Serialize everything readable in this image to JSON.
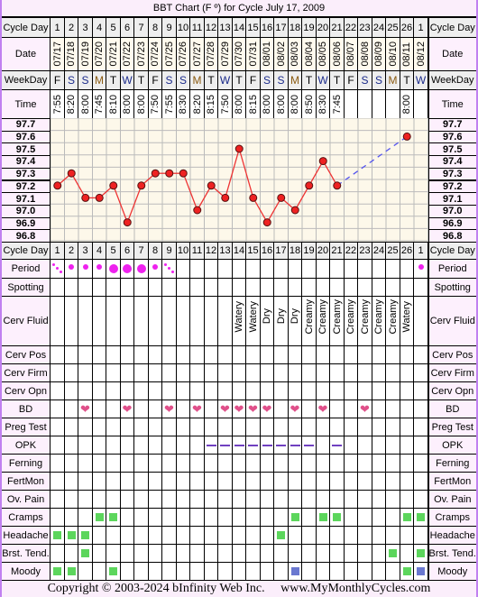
{
  "title": "BBT Chart (F º) for Cycle July 17, 2009",
  "labels": {
    "cycle_day": "Cycle Day",
    "date": "Date",
    "weekday": "WeekDay",
    "time": "Time",
    "period": "Period",
    "spotting": "Spotting",
    "cerv_fluid": "Cerv Fluid",
    "cerv_pos": "Cerv Pos",
    "cerv_firm": "Cerv Firm",
    "cerv_opn": "Cerv Opn",
    "bd": "BD",
    "preg_test": "Preg Test",
    "opk": "OPK",
    "ferning": "Ferning",
    "fertmon": "FertMon",
    "ov_pain": "Ov. Pain",
    "cramps": "Cramps",
    "headache": "Headache",
    "brst_tend": "Brst. Tend.",
    "moody": "Moody"
  },
  "cycle_days": [
    "1",
    "2",
    "3",
    "4",
    "5",
    "6",
    "7",
    "8",
    "9",
    "10",
    "11",
    "12",
    "13",
    "14",
    "15",
    "16",
    "17",
    "18",
    "19",
    "20",
    "21",
    "22",
    "23",
    "24",
    "25",
    "26",
    "1"
  ],
  "dates": [
    "07/17",
    "07/18",
    "07/19",
    "07/20",
    "07/21",
    "07/22",
    "07/23",
    "07/24",
    "07/25",
    "07/26",
    "07/27",
    "07/28",
    "07/29",
    "07/30",
    "07/31",
    "08/01",
    "08/02",
    "08/03",
    "08/04",
    "08/05",
    "08/06",
    "08/07",
    "08/08",
    "08/09",
    "08/10",
    "08/11",
    "08/12"
  ],
  "weekdays": [
    "F",
    "S",
    "S",
    "M",
    "T",
    "W",
    "T",
    "F",
    "S",
    "S",
    "M",
    "T",
    "W",
    "T",
    "F",
    "S",
    "S",
    "M",
    "T",
    "W",
    "T",
    "F",
    "S",
    "S",
    "M",
    "T",
    "W"
  ],
  "weekday_colors": {
    "S": "#1a2a8a",
    "M": "#8a5a10",
    "W": "#1a2a8a",
    "T": "#000000",
    "F": "#000000"
  },
  "times": [
    "7:55",
    "8:20",
    "8:00",
    "7:45",
    "8:10",
    "8:00",
    "8:00",
    "7:50",
    "7:55",
    "8:30",
    "8:20",
    "8:15",
    "7:50",
    "8:00",
    "8:15",
    "8:00",
    "8:00",
    "8:00",
    "8:50",
    "8:30",
    "7:45",
    "",
    "",
    "",
    "",
    "8:00",
    ""
  ],
  "chart_data": {
    "type": "line",
    "y_tick_labels": [
      "97.7",
      "97.6",
      "97.5",
      "97.4",
      "97.3",
      "97.2",
      "97.1",
      "97.0",
      "96.9",
      "96.8"
    ],
    "ylim": [
      96.8,
      97.7
    ],
    "grid": true,
    "x": [
      1,
      2,
      3,
      4,
      5,
      6,
      7,
      8,
      9,
      10,
      11,
      12,
      13,
      14,
      15,
      16,
      17,
      18,
      19,
      20,
      21,
      22,
      23,
      24,
      25,
      26,
      27
    ],
    "temps": [
      97.2,
      97.3,
      97.1,
      97.1,
      97.2,
      96.9,
      97.2,
      97.3,
      97.3,
      97.3,
      97.0,
      97.2,
      97.1,
      97.5,
      97.1,
      96.9,
      97.1,
      97.0,
      97.2,
      97.4,
      97.2,
      null,
      null,
      null,
      null,
      97.6,
      null
    ],
    "line_color": "#ee3333",
    "gap_line_color": "#5555ee"
  },
  "period": [
    "spot",
    "light",
    "light",
    "light",
    "heavy",
    "heavy",
    "heavy",
    "light",
    "spot",
    "",
    "",
    "",
    "",
    "",
    "",
    "",
    "",
    "",
    "",
    "",
    "",
    "",
    "",
    "",
    "",
    "",
    "light"
  ],
  "cerv_fluid": [
    "",
    "",
    "",
    "",
    "",
    "",
    "",
    "",
    "",
    "",
    "",
    "",
    "",
    "Watery",
    "Watery",
    "Dry",
    "Dry",
    "Dry",
    "Creamy",
    "Creamy",
    "Creamy",
    "Creamy",
    "Creamy",
    "Creamy",
    "Creamy",
    "Watery",
    ""
  ],
  "bd_days": [
    3,
    6,
    9,
    11,
    13,
    14,
    15,
    16,
    18,
    20,
    23
  ],
  "opk_negative_days": [
    12,
    13,
    14,
    15,
    16,
    17,
    18,
    19,
    21
  ],
  "cramps_days": [
    4,
    5,
    18,
    20,
    21,
    26,
    27
  ],
  "headache_days": [
    1,
    2,
    3,
    17
  ],
  "brst_tend_days": [
    3,
    25,
    27
  ],
  "moody": [
    {
      "day": 1,
      "color": "#5cd65c"
    },
    {
      "day": 2,
      "color": "#5cd65c"
    },
    {
      "day": 5,
      "color": "#5cd65c"
    },
    {
      "day": 18,
      "color": "#6a78d0"
    },
    {
      "day": 26,
      "color": "#5cd65c"
    },
    {
      "day": 27,
      "color": "#6a78d0"
    }
  ],
  "colors": {
    "period": "#ee22ee",
    "heart": "#e0508a",
    "opk": "#7040c0",
    "symptom": "#5cd65c",
    "frame": "#c080f0"
  },
  "copyright": "Copyright © 2003-2024 bInfinity Web Inc.     www.MyMonthlyCycles.com"
}
